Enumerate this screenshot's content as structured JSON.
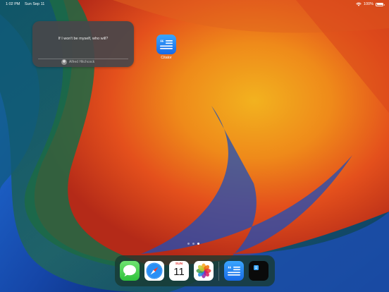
{
  "status_bar": {
    "time": "1:02 PM",
    "date": "Sun Sep 11",
    "battery_percent": "100%",
    "battery_level": 1.0
  },
  "widget": {
    "quote": "If I won't be myself, who will?",
    "author": "Alfred Hitchcock"
  },
  "home_icons": [
    {
      "label": "Citator",
      "icon": "quote-list-icon"
    }
  ],
  "page_indicator": {
    "pages": 3,
    "current": 3
  },
  "dock": {
    "apps": [
      {
        "icon": "messages-icon"
      },
      {
        "icon": "safari-compass-icon"
      },
      {
        "icon": "calendar-icon",
        "day": "SUN",
        "date": "11"
      },
      {
        "icon": "photos-flower-icon"
      },
      {
        "icon": "quote-list-icon"
      },
      {
        "icon": "dark-app-icon"
      }
    ]
  },
  "colors": {
    "accent_blue": "#1769e6",
    "calendar_red": "#e53935"
  }
}
